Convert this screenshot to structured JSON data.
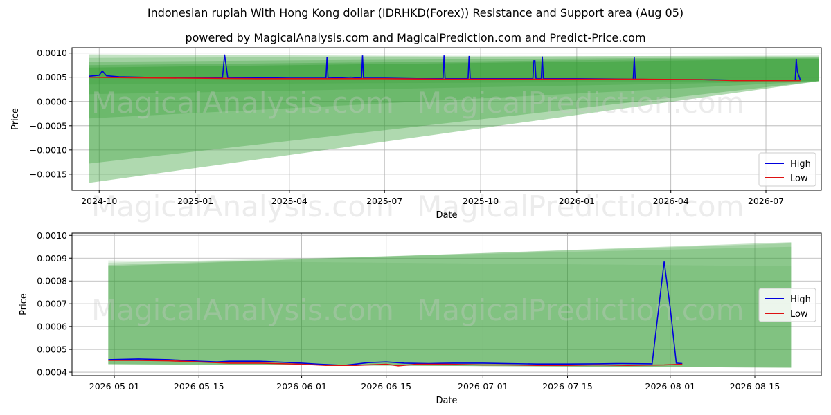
{
  "title": "Indonesian rupiah With Hong Kong dollar (IDRHKD(Forex)) Resistance and Support area (Aug 05)",
  "subtitle": "powered by MagicalAnalysis.com and MagicalPrediction.com and Predict-Price.com",
  "watermarks": [
    "MagicalAnalysis.com",
    "MagicalPrediction.com"
  ],
  "colors": {
    "high": "#0000dd",
    "low": "#dd1111",
    "band": "#2e9a2e"
  },
  "chart_data": [
    {
      "type": "line",
      "xlabel": "Date",
      "ylabel": "Price",
      "xlim": [
        "2024-09-05",
        "2026-08-23"
      ],
      "ylim": [
        -0.00183,
        0.00111
      ],
      "x_ticks": [
        "2024-10",
        "2025-01",
        "2025-04",
        "2025-07",
        "2025-10",
        "2026-01",
        "2026-04",
        "2026-07"
      ],
      "y_ticks": [
        "0.0010",
        "0.0005",
        "0.0000",
        "−0.0005",
        "−0.0010",
        "−0.0015"
      ],
      "y_tick_values": [
        0.001,
        0.0005,
        0.0,
        -0.0005,
        -0.001,
        -0.0015
      ],
      "legend": {
        "position": "lower-right",
        "entries": [
          "High",
          "Low"
        ]
      },
      "band_x": [
        "2024-09-21",
        "2026-08-21"
      ],
      "bands": [
        {
          "start": [
            0.00098,
            0.00052
          ],
          "end": [
            0.00088,
            0.00042
          ]
        },
        {
          "start": [
            0.00096,
            0.00035
          ],
          "end": [
            0.00093,
            0.00042
          ]
        },
        {
          "start": [
            0.0009,
            0.00015
          ],
          "end": [
            0.00095,
            0.00042
          ]
        },
        {
          "start": [
            0.00082,
            -0.00035
          ],
          "end": [
            0.00092,
            0.00042
          ]
        },
        {
          "start": [
            0.00075,
            -0.00128
          ],
          "end": [
            0.0009,
            0.00042
          ]
        },
        {
          "start": [
            0.0007,
            -0.00168
          ],
          "end": [
            0.00088,
            0.00042
          ]
        }
      ],
      "series": [
        {
          "name": "High",
          "x": [
            "2024-09-21",
            "2024-10-01",
            "2024-10-04",
            "2024-10-08",
            "2024-10-20",
            "2024-11-10",
            "2024-12-01",
            "2025-01-01",
            "2025-01-27",
            "2025-01-29",
            "2025-02-01",
            "2025-03-01",
            "2025-04-01",
            "2025-05-06",
            "2025-05-07",
            "2025-05-08",
            "2025-05-30",
            "2025-06-09",
            "2025-06-10",
            "2025-06-11",
            "2025-07-01",
            "2025-08-01",
            "2025-08-26",
            "2025-08-27",
            "2025-08-28",
            "2025-09-19",
            "2025-09-20",
            "2025-09-21",
            "2025-10-15",
            "2025-11-20",
            "2025-11-21",
            "2025-11-22",
            "2025-11-23",
            "2025-11-28",
            "2025-11-29",
            "2025-11-30",
            "2026-01-01",
            "2026-02-24",
            "2026-02-25",
            "2026-02-26",
            "2026-04-01",
            "2026-05-01",
            "2026-06-01",
            "2026-07-01",
            "2026-07-29",
            "2026-07-30",
            "2026-07-31",
            "2026-08-03"
          ],
          "values": [
            0.00052,
            0.00054,
            0.00063,
            0.00053,
            0.00051,
            0.0005,
            0.00049,
            0.00049,
            0.00049,
            0.00097,
            0.00049,
            0.00049,
            0.00048,
            0.00048,
            0.00091,
            0.00048,
            0.0005,
            0.00048,
            0.00095,
            0.00048,
            0.00048,
            0.00047,
            0.00047,
            0.00095,
            0.00047,
            0.00047,
            0.00094,
            0.00047,
            0.00047,
            0.00047,
            0.00084,
            0.00084,
            0.00047,
            0.00047,
            0.00093,
            0.00047,
            0.00047,
            0.00046,
            0.00091,
            0.00046,
            0.00045,
            0.00045,
            0.00044,
            0.00044,
            0.00044,
            0.00088,
            0.00062,
            0.00044
          ]
        },
        {
          "name": "Low",
          "x": [
            "2024-09-21",
            "2024-11-01",
            "2025-01-01",
            "2025-03-01",
            "2025-05-01",
            "2025-07-01",
            "2025-09-01",
            "2025-11-01",
            "2026-01-01",
            "2026-03-01",
            "2026-05-01",
            "2026-06-01",
            "2026-07-01",
            "2026-08-03"
          ],
          "values": [
            0.0005,
            0.00049,
            0.00048,
            0.00047,
            0.00047,
            0.00047,
            0.00046,
            0.00046,
            0.00046,
            0.00046,
            0.00045,
            0.00043,
            0.00043,
            0.00043
          ]
        }
      ]
    },
    {
      "type": "line",
      "xlabel": "Date",
      "ylabel": "Price",
      "xlim": [
        "2026-04-24",
        "2026-08-26"
      ],
      "ylim": [
        0.000385,
        0.00101
      ],
      "x_ticks": [
        "2026-05-01",
        "2026-05-15",
        "2026-06-01",
        "2026-06-15",
        "2026-07-01",
        "2026-07-15",
        "2026-08-01",
        "2026-08-15"
      ],
      "y_ticks": [
        "0.0010",
        "0.0009",
        "0.0008",
        "0.0007",
        "0.0006",
        "0.0005",
        "0.0004"
      ],
      "y_tick_values": [
        0.001,
        0.0009,
        0.0008,
        0.0007,
        0.0006,
        0.0005,
        0.0004
      ],
      "legend": {
        "position": "center-right",
        "entries": [
          "High",
          "Low"
        ]
      },
      "band_x": [
        "2026-04-30",
        "2026-08-21"
      ],
      "bands": [
        {
          "start": [
            0.00089,
            0.000435
          ],
          "end": [
            0.000865,
            0.00042
          ]
        },
        {
          "start": [
            0.00088,
            0.000435
          ],
          "end": [
            0.00095,
            0.00042
          ]
        },
        {
          "start": [
            0.00087,
            0.000435
          ],
          "end": [
            0.000965,
            0.00042
          ]
        },
        {
          "start": [
            0.000865,
            0.000435
          ],
          "end": [
            0.00097,
            0.00042
          ]
        }
      ],
      "series": [
        {
          "name": "High",
          "x": [
            "2026-04-30",
            "2026-05-05",
            "2026-05-10",
            "2026-05-15",
            "2026-05-18",
            "2026-05-20",
            "2026-05-25",
            "2026-06-01",
            "2026-06-04",
            "2026-06-08",
            "2026-06-12",
            "2026-06-15",
            "2026-06-18",
            "2026-06-22",
            "2026-06-26",
            "2026-07-01",
            "2026-07-05",
            "2026-07-10",
            "2026-07-15",
            "2026-07-20",
            "2026-07-24",
            "2026-07-29",
            "2026-07-31",
            "2026-08-01",
            "2026-08-02",
            "2026-08-03"
          ],
          "values": [
            0.000455,
            0.000458,
            0.000455,
            0.000448,
            0.000445,
            0.000448,
            0.000448,
            0.00044,
            0.000435,
            0.00043,
            0.000442,
            0.000445,
            0.00044,
            0.000438,
            0.00044,
            0.00044,
            0.000438,
            0.000436,
            0.000436,
            0.000437,
            0.000438,
            0.000437,
            0.000885,
            0.00068,
            0.00044,
            0.000438
          ]
        },
        {
          "name": "Low",
          "x": [
            "2026-04-30",
            "2026-05-05",
            "2026-05-10",
            "2026-05-15",
            "2026-05-20",
            "2026-05-25",
            "2026-06-01",
            "2026-06-05",
            "2026-06-10",
            "2026-06-15",
            "2026-06-17",
            "2026-06-20",
            "2026-06-25",
            "2026-07-01",
            "2026-07-05",
            "2026-07-10",
            "2026-07-15",
            "2026-07-20",
            "2026-07-25",
            "2026-07-31",
            "2026-08-03"
          ],
          "values": [
            0.000452,
            0.000452,
            0.00045,
            0.000445,
            0.00044,
            0.00044,
            0.000435,
            0.00043,
            0.00043,
            0.000435,
            0.000428,
            0.000435,
            0.000435,
            0.000432,
            0.000432,
            0.00043,
            0.00043,
            0.000432,
            0.00043,
            0.000432,
            0.000435
          ]
        }
      ]
    }
  ]
}
